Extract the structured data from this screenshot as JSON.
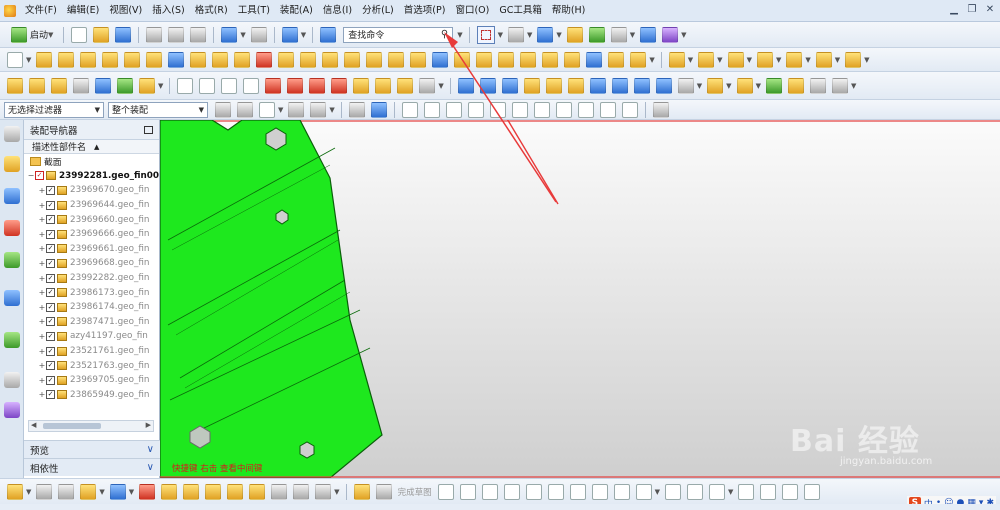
{
  "menubar": {
    "items": [
      "文件(F)",
      "编辑(E)",
      "视图(V)",
      "插入(S)",
      "格式(R)",
      "工具(T)",
      "装配(A)",
      "信息(I)",
      "分析(L)",
      "首选项(P)",
      "窗口(O)",
      "GC工具箱",
      "帮助(H)"
    ]
  },
  "toolbar": {
    "start_label": "启动",
    "command_search_placeholder": "查找命令",
    "selection_filter": "无选择过滤器",
    "assembly_scope": "整个装配"
  },
  "navigator": {
    "title": "装配导航器",
    "column_header": "描述性部件名",
    "root_section": "截面",
    "assembly": "23992281.geo_fin00:",
    "parts": [
      "23969670.geo_fin",
      "23969644.geo_fin",
      "23969660.geo_fin",
      "23969666.geo_fin",
      "23969661.geo_fin",
      "23969668.geo_fin",
      "23992282.geo_fin",
      "23986173.geo_fin",
      "23986174.geo_fin",
      "23987471.geo_fin",
      "azy41197.geo_fin",
      "23521761.geo_fin",
      "23521763.geo_fin",
      "23969705.geo_fin",
      "23865949.geo_fin"
    ],
    "preview_label": "预览",
    "dependency_label": "相依性"
  },
  "viewport": {
    "prompt_text": "快捷键 右击 查看中间键"
  },
  "bottom_toolbar": {
    "finish_sketch_label": "完成草图"
  },
  "ime": {
    "brand": "S",
    "mode": "中"
  },
  "watermark": {
    "text": "Bai 经验",
    "url": "jingyan.baidu.com"
  },
  "colors": {
    "model_green": "#1ee81e",
    "annotation_red": "#e83a3a"
  }
}
